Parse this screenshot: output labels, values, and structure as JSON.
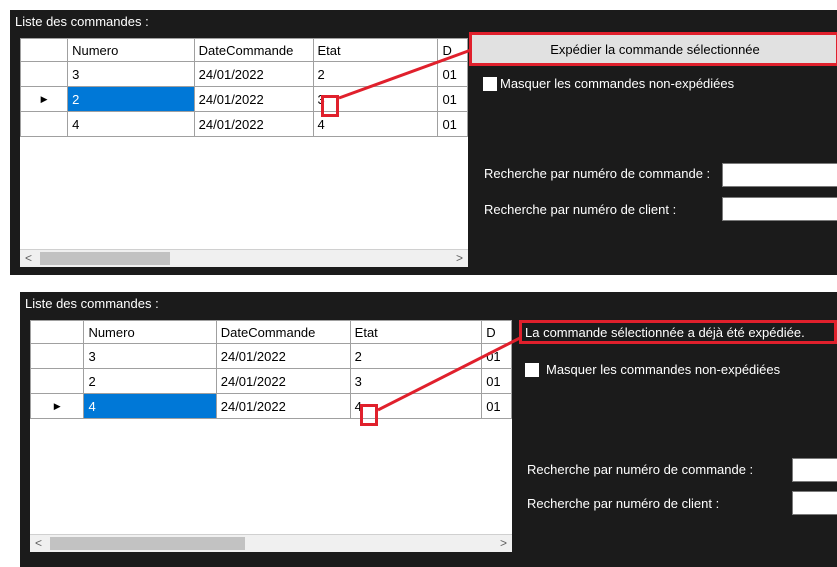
{
  "accent_color": "#e0202c",
  "selection_color": "#0078d7",
  "panel1": {
    "list_label": "Liste des commandes :",
    "columns": [
      "Numero",
      "DateCommande",
      "Etat",
      "D"
    ],
    "rows": [
      {
        "numero": "3",
        "date": "24/01/2022",
        "etat": "2",
        "d": "01"
      },
      {
        "numero": "2",
        "date": "24/01/2022",
        "etat": "3",
        "d": "01"
      },
      {
        "numero": "4",
        "date": "24/01/2022",
        "etat": "4",
        "d": "01"
      }
    ],
    "selected_row": 1,
    "ship_button": "Expédier la commande sélectionnée",
    "hide_checkbox_label": "Masquer les commandes non-expédiées",
    "search_order_label": "Recherche par numéro de commande :",
    "search_client_label": "Recherche par numéro de client :",
    "scroll_left": "<",
    "scroll_right": ">"
  },
  "panel2": {
    "list_label": "Liste des commandes :",
    "columns": [
      "Numero",
      "DateCommande",
      "Etat",
      "D"
    ],
    "rows": [
      {
        "numero": "3",
        "date": "24/01/2022",
        "etat": "2",
        "d": "01"
      },
      {
        "numero": "2",
        "date": "24/01/2022",
        "etat": "3",
        "d": "01"
      },
      {
        "numero": "4",
        "date": "24/01/2022",
        "etat": "4",
        "d": "01"
      }
    ],
    "selected_row": 2,
    "message": "La commande sélectionnée a déjà été expédiée.",
    "hide_checkbox_label": "Masquer les commandes non-expédiées",
    "search_order_label": "Recherche par numéro de commande :",
    "search_client_label": "Recherche par numéro de client :",
    "scroll_left": "<",
    "scroll_right": ">"
  }
}
